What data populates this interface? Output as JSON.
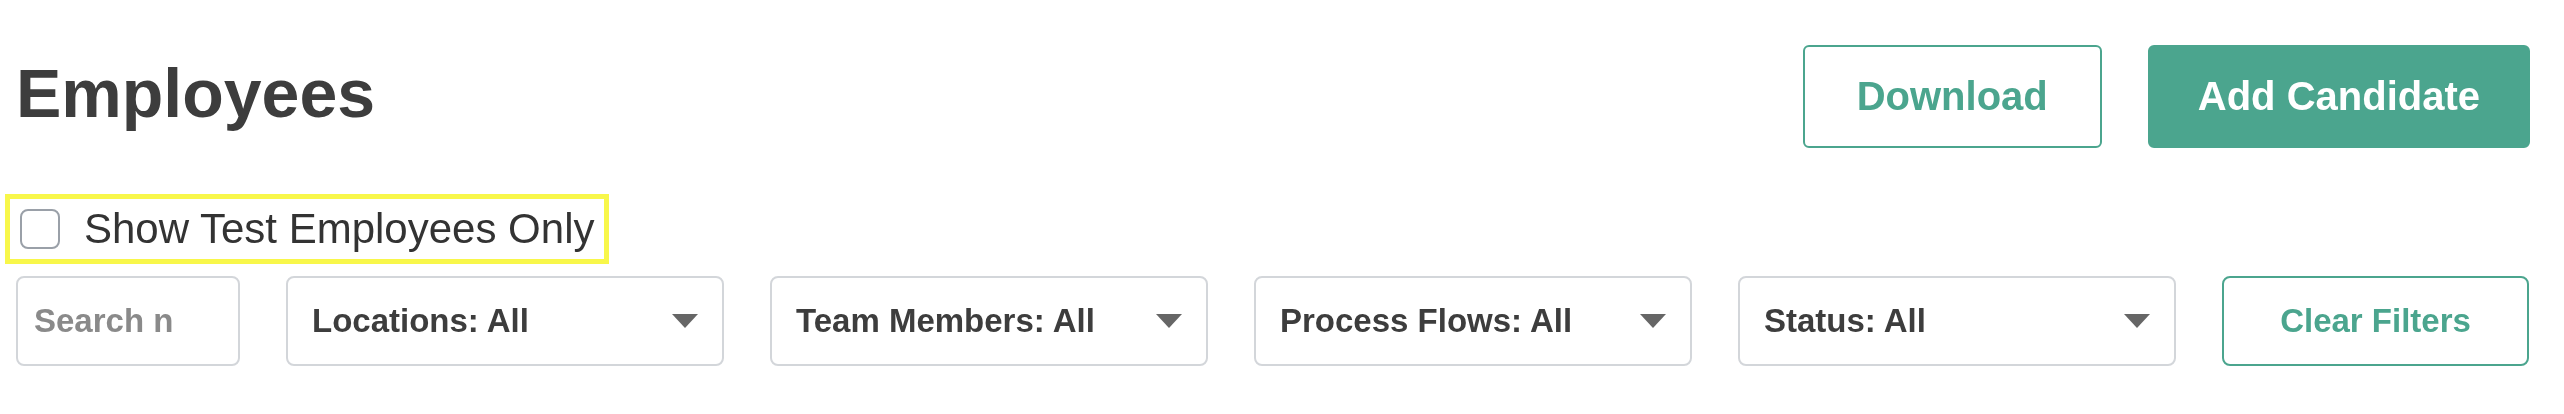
{
  "title": "Employees",
  "actions": [
    {
      "label": "Download",
      "kind": "outline"
    },
    {
      "label": "Add Candidate",
      "kind": "primary"
    }
  ],
  "test_filter": {
    "label": "Show Test Employees Only",
    "checked": false,
    "highlighted": true
  },
  "search": {
    "placeholder": "Search n"
  },
  "dropdowns": [
    {
      "label": "Locations: All"
    },
    {
      "label": "Team Members: All"
    },
    {
      "label": "Process Flows: All"
    },
    {
      "label": "Status: All"
    }
  ],
  "clear_button": "Clear Filters"
}
